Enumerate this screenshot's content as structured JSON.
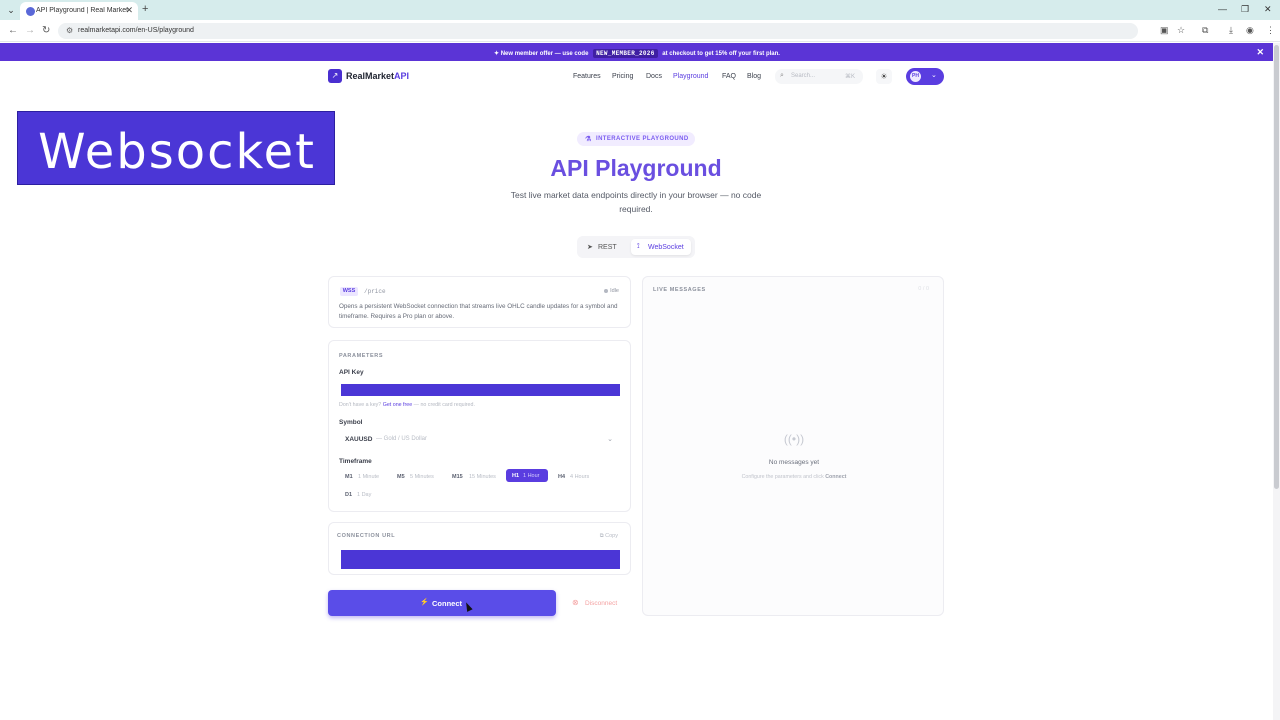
{
  "browser": {
    "tab_title": "API Playground | Real Market A",
    "url": "realmarketapi.com/en-US/playground"
  },
  "promo": {
    "text_before": "New member offer — use code",
    "code": "NEW_MEMBER_2026",
    "text_after": "at checkout to get 15% off your first plan."
  },
  "header": {
    "brand_main": "RealMarket",
    "brand_accent": "API",
    "nav": [
      "Features",
      "Pricing",
      "Docs",
      "Playground",
      "FAQ",
      "Blog"
    ],
    "active_nav": "Playground",
    "search_placeholder": "Search...",
    "search_shortcut": "⌘K",
    "user_initials": "PH"
  },
  "overlay": {
    "text": "Websocket"
  },
  "hero": {
    "badge": "INTERACTIVE PLAYGROUND",
    "title": "API Playground",
    "subtitle": "Test live market data endpoints directly in your browser — no code required."
  },
  "mode_toggle": {
    "rest": "REST",
    "websocket": "WebSocket",
    "selected": "WebSocket"
  },
  "endpoint": {
    "method": "WSS",
    "path": "/price",
    "status": "Idle",
    "description": "Opens a persistent WebSocket connection that streams live OHLC candle updates for a symbol and timeframe. Requires a Pro plan or above."
  },
  "parameters": {
    "section_title": "PARAMETERS",
    "api_key_label": "API Key",
    "help_before": "Don't have a key?",
    "help_link": "Get one free",
    "help_after": "— no credit card required.",
    "symbol_label": "Symbol",
    "symbol_value": "XAUUSD",
    "symbol_desc": "— Gold / US Dollar",
    "timeframe_label": "Timeframe",
    "timeframes": [
      {
        "code": "M1",
        "desc": "1 Minute"
      },
      {
        "code": "M5",
        "desc": "5 Minutes"
      },
      {
        "code": "M15",
        "desc": "15 Minutes"
      },
      {
        "code": "H1",
        "desc": "1 Hour"
      },
      {
        "code": "H4",
        "desc": "4 Hours"
      },
      {
        "code": "D1",
        "desc": "1 Day"
      }
    ],
    "selected_timeframe": "H1"
  },
  "connection": {
    "section_title": "CONNECTION URL",
    "copy_label": "Copy"
  },
  "actions": {
    "connect": "Connect",
    "disconnect": "Disconnect"
  },
  "live": {
    "section_title": "LIVE MESSAGES",
    "tag": "0 / 0",
    "empty_title": "No messages yet",
    "empty_sub_before": "Configure the parameters and click",
    "empty_sub_bold": "Connect"
  },
  "colors": {
    "brand": "#5a3de0",
    "promo_bg": "#5b34d6",
    "overlay_bg": "#4b36d6"
  }
}
